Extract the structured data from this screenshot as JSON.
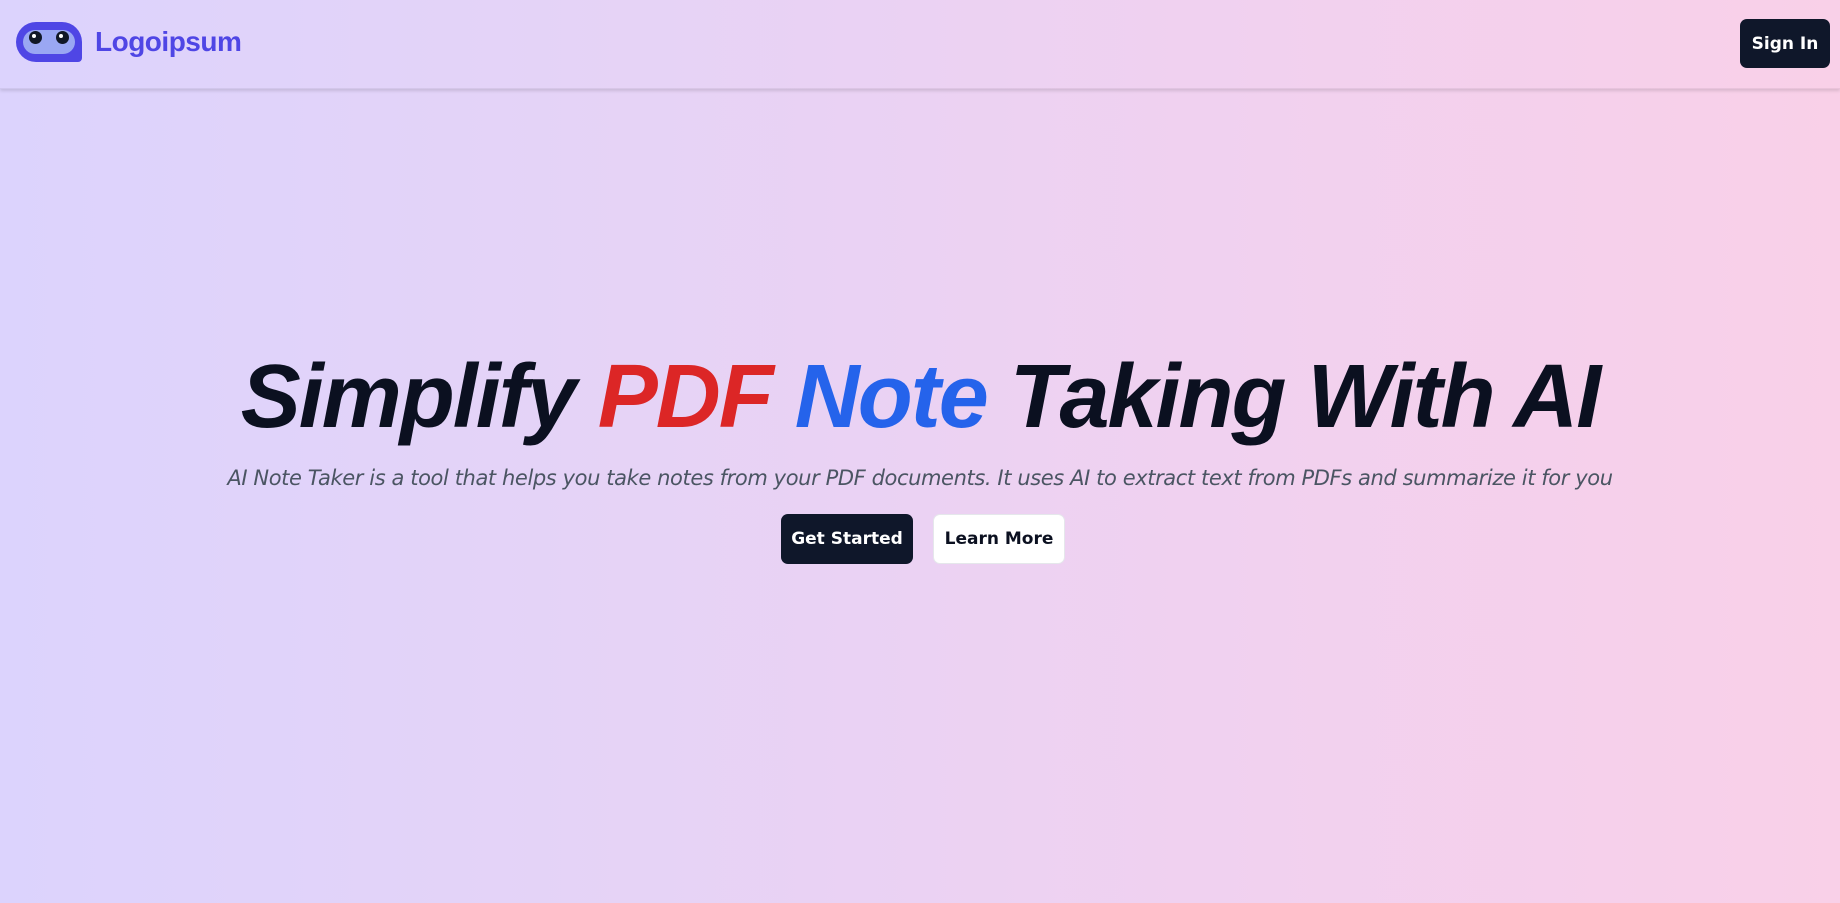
{
  "header": {
    "logo_text": "Logoipsum",
    "sign_in_label": "Sign In"
  },
  "hero": {
    "title_part1": "Simplify ",
    "title_pdf": "PDF",
    "title_note": "Note",
    "title_part2": " Taking With AI",
    "subtitle": "AI Note Taker is a tool that helps you take notes from your PDF documents. It uses AI to extract text from PDFs and summarize it for you",
    "primary_button": "Get Started",
    "secondary_button": "Learn More"
  },
  "colors": {
    "brand": "#4f46e5",
    "dark": "#0f172a",
    "accent_red": "#dc2626",
    "accent_blue": "#2563eb"
  }
}
